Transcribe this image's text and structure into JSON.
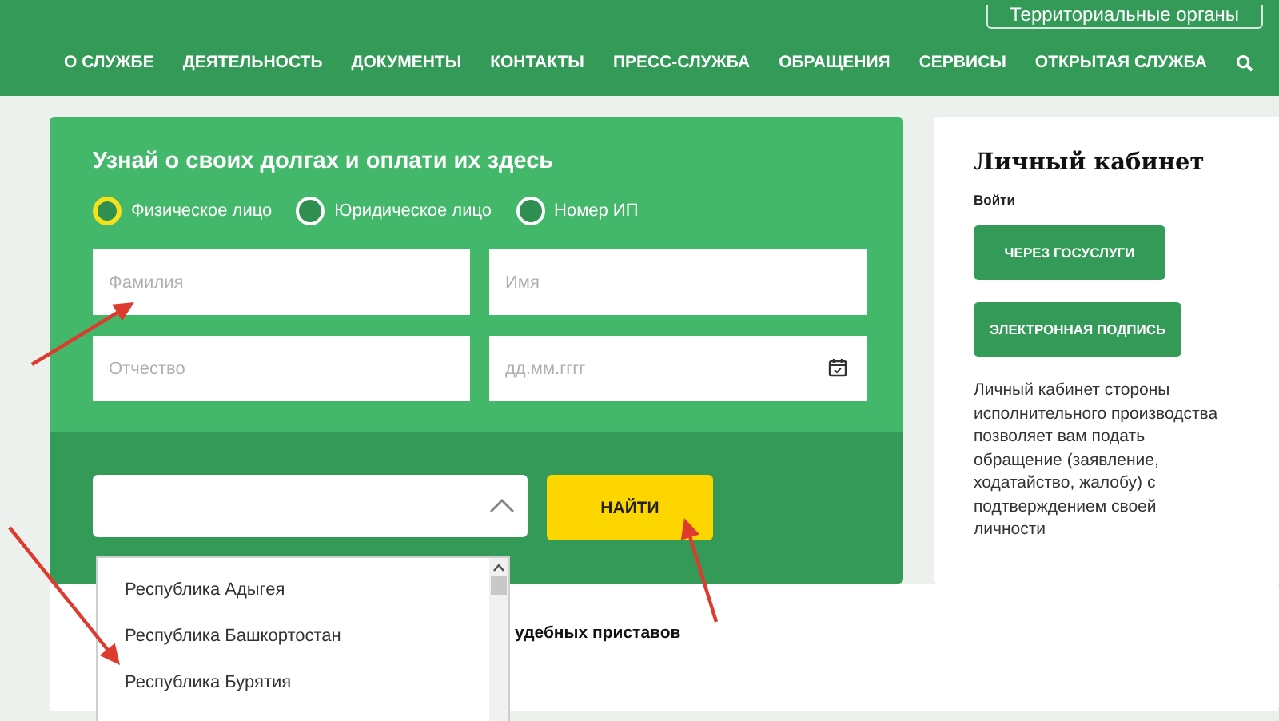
{
  "header": {
    "territorial_button": "Территориальные органы"
  },
  "nav": {
    "items": [
      "О СЛУЖБЕ",
      "ДЕЯТЕЛЬНОСТЬ",
      "ДОКУМЕНТЫ",
      "КОНТАКТЫ",
      "ПРЕСС-СЛУЖБА",
      "ОБРАЩЕНИЯ",
      "СЕРВИСЫ",
      "ОТКРЫТАЯ СЛУЖБА"
    ]
  },
  "debt_form": {
    "title": "Узнай о своих долгах и оплати их здесь",
    "person_types": [
      {
        "label": "Физическое лицо",
        "selected": true
      },
      {
        "label": "Юридическое лицо",
        "selected": false
      },
      {
        "label": "Номер ИП",
        "selected": false
      }
    ],
    "fields": [
      {
        "kind": "text",
        "placeholder": "Фамилия"
      },
      {
        "kind": "text",
        "placeholder": "Имя"
      },
      {
        "kind": "text",
        "placeholder": "Отчество"
      },
      {
        "kind": "date",
        "placeholder": "дд.мм.гггг"
      }
    ],
    "region_select": {
      "expanded": true,
      "options": [
        "Республика Адыгея",
        "Республика Башкортостан",
        "Республика Бурятия"
      ]
    },
    "search_button": "НАЙТИ"
  },
  "cabinet": {
    "title": "Личный кабинет",
    "login_label": "Войти",
    "buttons": [
      "ЧЕРЕЗ ГОСУСЛУГИ",
      "ЭЛЕКТРОННАЯ ПОДПИСЬ"
    ],
    "description": "Личный кабинет стороны исполнительного производства позволяет вам подать обращение (заявление, ходатайство, жалобу) с подтверждением своей личности"
  },
  "bottom_card": {
    "heading": "удебных приставов"
  }
}
